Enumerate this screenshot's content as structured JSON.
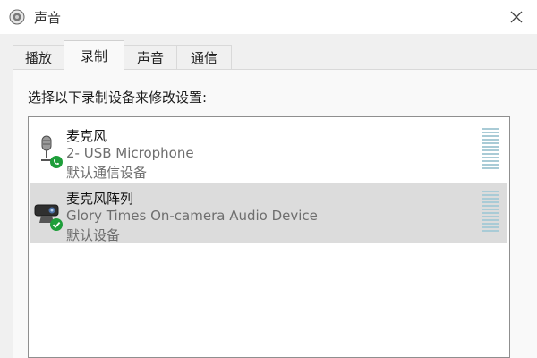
{
  "window": {
    "title": "声音"
  },
  "tabs": [
    {
      "label": "播放",
      "active": false
    },
    {
      "label": "录制",
      "active": true
    },
    {
      "label": "声音",
      "active": false
    },
    {
      "label": "通信",
      "active": false
    }
  ],
  "recording": {
    "instruction": "选择以下录制设备来修改设置:",
    "devices": [
      {
        "name": "麦克风",
        "description": "2- USB Microphone",
        "status": "默认通信设备",
        "icon": "microphone-icon",
        "status_icon": "phone-badge-icon",
        "selected": false
      },
      {
        "name": "麦克风阵列",
        "description": "Glory Times On-camera Audio Device",
        "status": "默认设备",
        "icon": "webcam-icon",
        "status_icon": "check-badge-icon",
        "selected": true
      }
    ]
  },
  "colors": {
    "selected_row": "#dcdcdc",
    "badge_green": "#1e9e3a",
    "meter_bar": "#a9cbd6"
  }
}
